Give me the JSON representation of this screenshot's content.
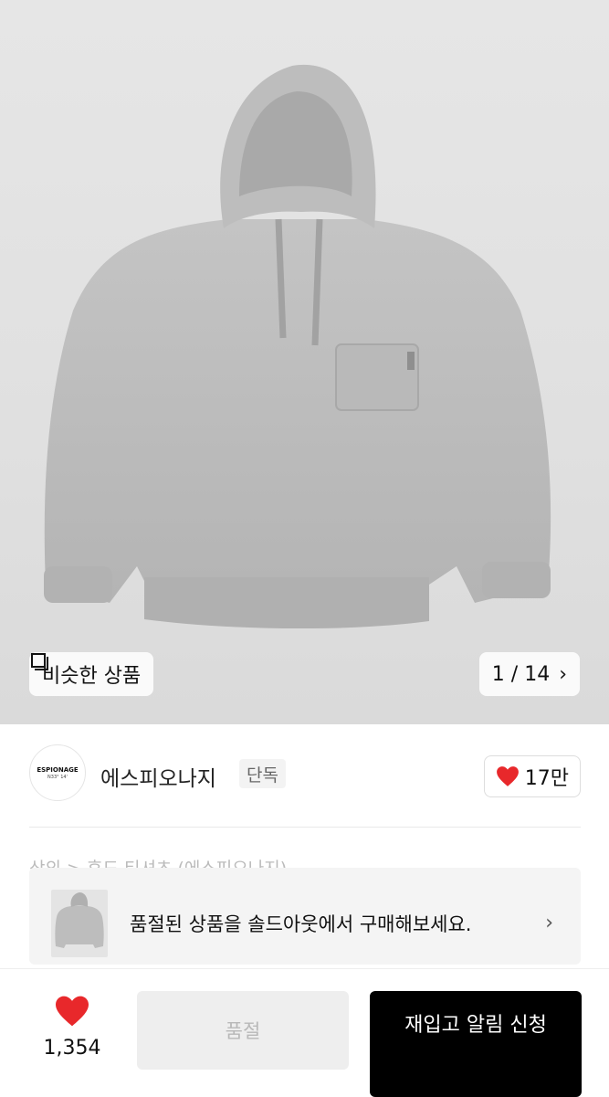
{
  "hero": {
    "similar_label": "비슷한 상품",
    "pager_text": "1 / 14"
  },
  "brand": {
    "logo_line1": "ESPIONAGE",
    "logo_line2": "N33° 14'",
    "name": "에스피오나지",
    "badge": "단독",
    "like_count": "17만"
  },
  "breadcrumb": "상의 > 후드 티셔츠 (에스피오나지)",
  "soldout_banner": {
    "text": "품절된 상품을 솔드아웃에서 구매해보세요."
  },
  "bottom_bar": {
    "wish_count": "1,354",
    "soldout_label": "품절",
    "restock_label": "재입고 알림 신청"
  },
  "colors": {
    "heart": "#e8282b",
    "primary_button": "#000000",
    "disabled_button": "#eeeeee"
  }
}
